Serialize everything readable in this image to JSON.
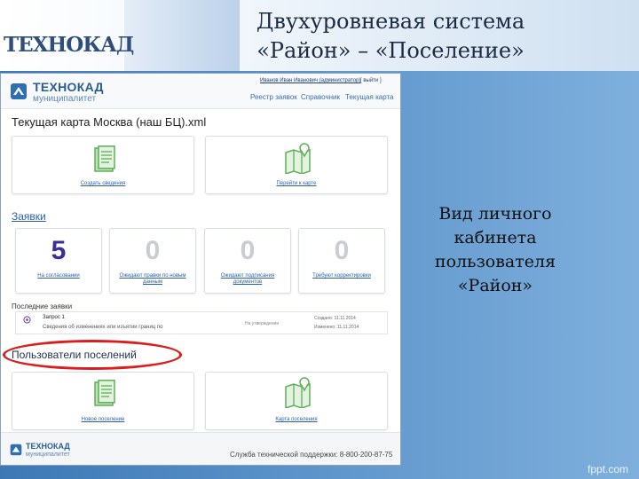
{
  "slide": {
    "title_line1": "Двухуровневая система",
    "title_line2": "«Район» – «Поселение»",
    "caption_lines": [
      "Вид личного",
      "кабинета",
      "пользователя",
      "«Район»"
    ],
    "watermark": "fppt.com",
    "brand_logo": "ТЕХНОКАД"
  },
  "app": {
    "logo_name": "ТЕХНОКАД",
    "logo_sub": "муниципалитет",
    "user_line": "Иванов Иван Иванович (администратор)",
    "exit_label": "[ выйти ]",
    "nav": [
      "Реестр заявок",
      "Справочник",
      "Текущая карта"
    ],
    "current_map_title": "Текущая карта Москва (наш БЦ).xml",
    "map_cards": [
      {
        "label": "Создать сведения",
        "icon": "document-icon"
      },
      {
        "label": "Перейти к карте",
        "icon": "map-icon"
      }
    ],
    "requests_heading": "Заявки",
    "stats": [
      {
        "value": "5",
        "label": "На согласовании",
        "active": true
      },
      {
        "value": "0",
        "label": "Ожидают правки по новым данным",
        "active": false
      },
      {
        "value": "0",
        "label": "Ожидают подписания документов",
        "active": false
      },
      {
        "value": "0",
        "label": "Требуют корректировки",
        "active": false
      }
    ],
    "recent_label": "Последние заявки",
    "recent_request": {
      "title": "Запрос 1",
      "description": "Сведения об изменениях или изъятии границ по",
      "status": "На утверждении",
      "created": "Создано: 11.11.2014",
      "modified": "Изменено: 11.11.2014"
    },
    "settlements_heading": "Пользователи поселений",
    "settlement_cards": [
      {
        "label": "Новое поселение",
        "icon": "document-icon"
      },
      {
        "label": "Карта поселения",
        "icon": "map-icon"
      }
    ],
    "footer": {
      "logo_name": "ТЕХНОКАД",
      "logo_sub": "муниципалитет",
      "support": "Служба технической поддержки: 8-800-200-87-75"
    }
  },
  "colors": {
    "accent_blue": "#2a5fa8",
    "stat_active": "#3a2f96",
    "icon_green": "#5fae5a",
    "highlight_red": "#d81e1e"
  }
}
